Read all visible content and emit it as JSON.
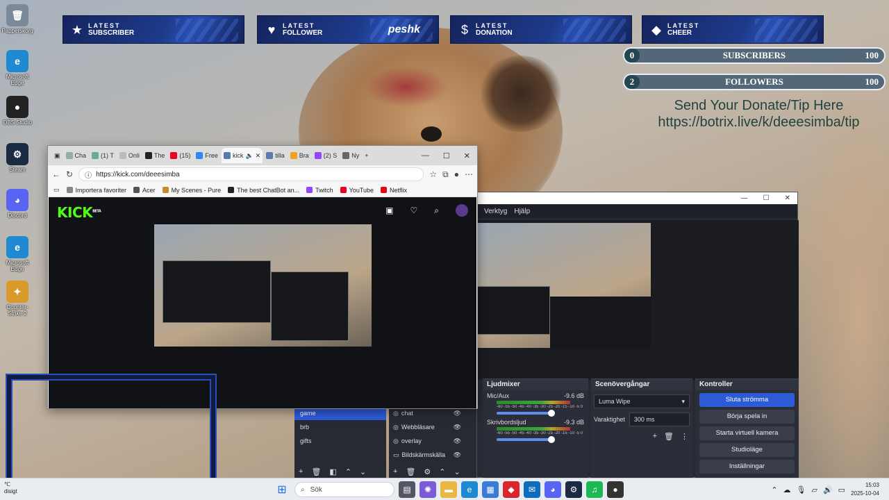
{
  "desktop": {
    "icons": [
      {
        "label": "Papperskorg",
        "color": "#7a8a9a",
        "glyph": "🗑"
      },
      {
        "label": "Microsoft Edge",
        "color": "#1f8ad1",
        "glyph": "e"
      },
      {
        "label": "OBS Studio",
        "color": "#222222",
        "glyph": "●"
      },
      {
        "label": "Steam",
        "color": "#1b2b44",
        "glyph": "⚙"
      },
      {
        "label": "Discord",
        "color": "#5865f2",
        "glyph": "◕"
      },
      {
        "label": "Microsoft Edge",
        "color": "#1f8ad1",
        "glyph": "e"
      },
      {
        "label": "Counter-Strike 2",
        "color": "#d89b2b",
        "glyph": "✦"
      }
    ]
  },
  "alerts": [
    {
      "line1": "LATEST",
      "line2": "SUBSCRIBER",
      "icon": "star-icon",
      "glyph": "★",
      "value": ""
    },
    {
      "line1": "LATEST",
      "line2": "FOLLOWER",
      "icon": "heart-icon",
      "glyph": "♥",
      "value": "peshk"
    },
    {
      "line1": "LATEST",
      "line2": "DONATION",
      "icon": "dollar-icon",
      "glyph": "$",
      "value": ""
    },
    {
      "line1": "LATEST",
      "line2": "CHEER",
      "icon": "diamond-icon",
      "glyph": "◆",
      "value": ""
    }
  ],
  "goals": [
    {
      "current": "0",
      "label": "SUBSCRIBERS",
      "max": "100"
    },
    {
      "current": "2",
      "label": "FOLLOWERS",
      "max": "100"
    }
  ],
  "donate": {
    "line1": "Send Your Donate/Tip Here",
    "line2": "https://botrix.live/k/deeesimba/tip"
  },
  "browser": {
    "tabs": [
      {
        "label": "Cha",
        "color": "#9aa"
      },
      {
        "label": "(1) T",
        "color": "#6a9"
      },
      {
        "label": "Onli",
        "color": "#bbb"
      },
      {
        "label": "The",
        "color": "#222"
      },
      {
        "label": "(15)",
        "color": "#e02"
      },
      {
        "label": "Free",
        "color": "#2a8cf0"
      },
      {
        "label": "kick",
        "color": "#5a7ab0"
      },
      {
        "label": "tilla",
        "color": "#5a7ab0"
      },
      {
        "label": "Bra",
        "color": "#f4a020"
      },
      {
        "label": "(2) S",
        "color": "#9146ff"
      },
      {
        "label": "Ny",
        "color": "#666"
      }
    ],
    "active_tab_index": 6,
    "url": "https://kick.com/deeesimba",
    "favorites": [
      {
        "label": "Importera favoriter",
        "color": "#888"
      },
      {
        "label": "Acer",
        "color": "#555"
      },
      {
        "label": "My Scenes - Pure",
        "color": "#c88a2a"
      },
      {
        "label": "The best ChatBot an...",
        "color": "#222"
      },
      {
        "label": "Twitch",
        "color": "#9146ff"
      },
      {
        "label": "YouTube",
        "color": "#e02"
      },
      {
        "label": "Netflix",
        "color": "#e50914"
      }
    ],
    "kick_logo": "KICK",
    "kick_logo_badge": "BETA",
    "accent": "#53fc18"
  },
  "obs": {
    "menu": [
      "Verktyg",
      "Hjälp"
    ],
    "mixer_title": "Ljudmixer",
    "channels": [
      {
        "name": "Mic/Aux",
        "db": "-9.6 dB",
        "fill": 0.86
      },
      {
        "name": "Skrivbordsljud",
        "db": "-9.3 dB",
        "fill": 0.86
      }
    ],
    "meter_scale": "-60 -55 -50 -45 -40 -35 -30 -25 -20 -15 -10 -5 0",
    "transitions_title": "Scenövergångar",
    "transition": "Luma Wipe",
    "duration_label": "Varaktighet",
    "duration": "300 ms",
    "controls_title": "Kontroller",
    "controls": [
      "Sluta strömma",
      "Börja spela in",
      "Starta virtuell kamera",
      "Studioläge",
      "Inställningar"
    ],
    "scenes": [
      "game",
      "brb",
      "gifts"
    ],
    "selected_scene": 0,
    "sources": [
      "chat",
      "Webbläsare",
      "overlay",
      "Bildskärmskälla"
    ]
  },
  "taskbar": {
    "search_placeholder": "Sök",
    "time": "15:03",
    "date": "2025-10-04",
    "weather_temp": "℃",
    "weather_text": "disigt"
  }
}
